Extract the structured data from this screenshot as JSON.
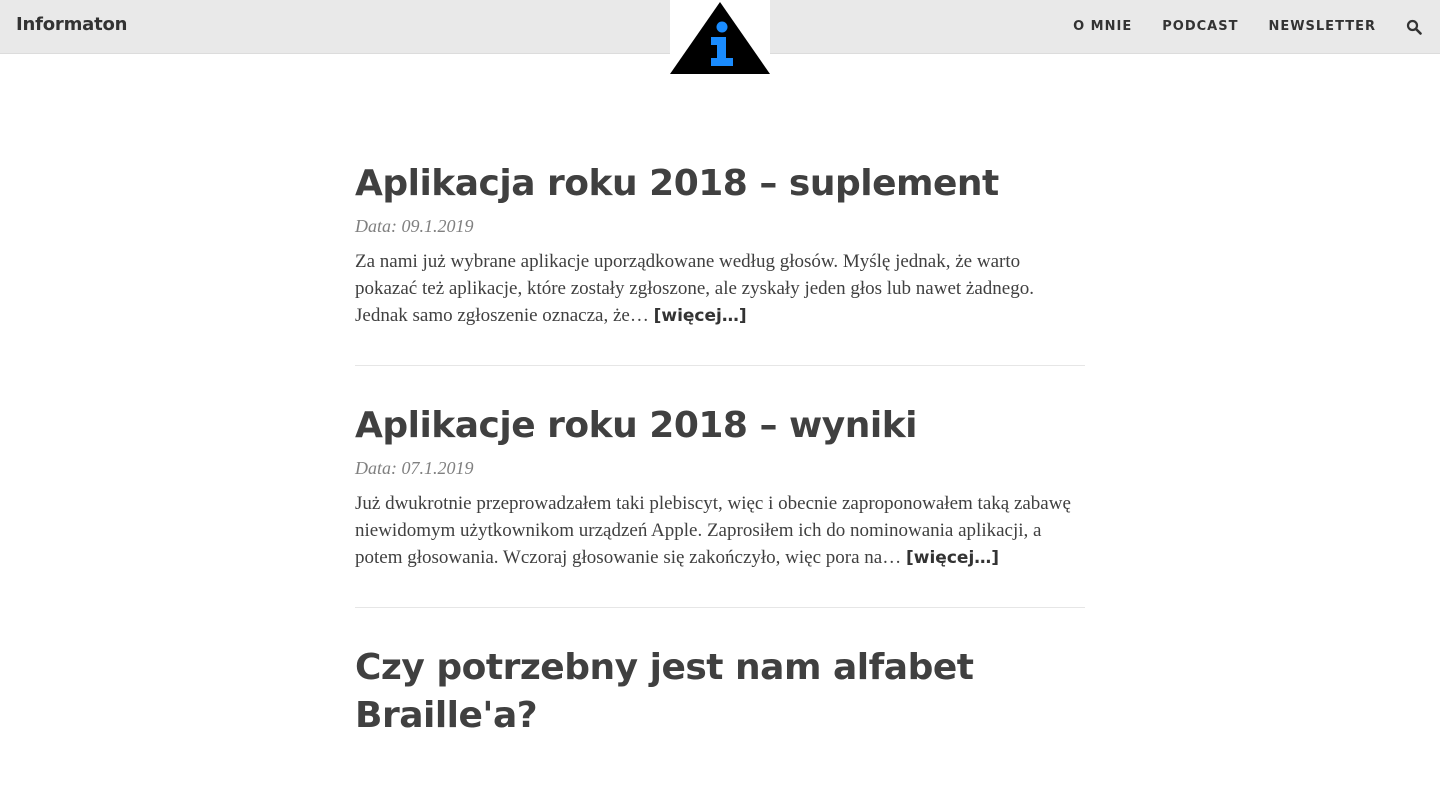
{
  "header": {
    "site_title": "Informaton",
    "nav": [
      {
        "label": "O MNIE"
      },
      {
        "label": "PODCAST"
      },
      {
        "label": "NEWSLETTER"
      }
    ],
    "search_icon": "search-icon",
    "logo_icon": "info-triangle-logo"
  },
  "colors": {
    "header_bg": "#e9e9e9",
    "logo_blue": "#1a8cff",
    "logo_black": "#000000",
    "text": "#404040",
    "date": "#808080"
  },
  "posts": [
    {
      "title": "Aplikacja roku 2018 – suplement",
      "date": "Data: 09.1.2019",
      "excerpt": "Za nami już wybrane aplikacje uporządkowane według głosów. Myślę jednak, że warto pokazać też aplikacje, które zostały zgłoszone, ale zyskały jeden głos lub nawet żadnego. Jednak samo zgłoszenie oznacza, że…",
      "more": "[więcej…]"
    },
    {
      "title": "Aplikacje roku 2018 – wyniki",
      "date": "Data: 07.1.2019",
      "excerpt": "Już dwukrotnie przeprowadzałem taki plebiscyt, więc i obecnie zaproponowałem taką zabawę niewidomym użytkownikom urządzeń Apple. Zaprosiłem ich do nominowania aplikacji, a potem głosowania. Wczoraj głosowanie się zakończyło, więc pora na…",
      "more": "[więcej…]"
    },
    {
      "title": "Czy potrzebny jest nam alfabet Braille'a?"
    }
  ]
}
